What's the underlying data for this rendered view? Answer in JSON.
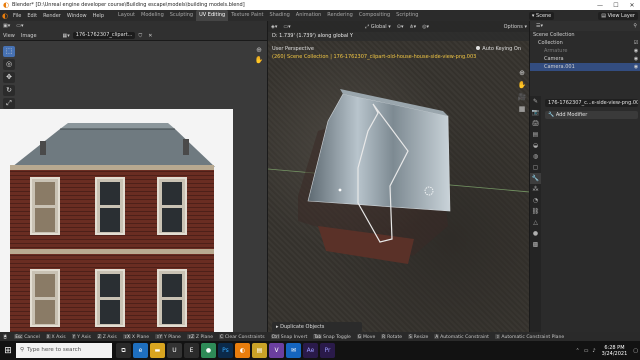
{
  "window": {
    "title": "Blender* [D:\\Unreal engine developer course\\Building escape\\models\\building models.blend]",
    "minimize": "—",
    "maximize": "☐",
    "close": "✕"
  },
  "menubar": {
    "items": [
      "File",
      "Edit",
      "Render",
      "Window",
      "Help"
    ]
  },
  "workspaces": {
    "tabs": [
      "Layout",
      "Modeling",
      "Sculpting",
      "UV Editing",
      "Texture Paint",
      "Shading",
      "Animation",
      "Rendering",
      "Compositing",
      "Scripting"
    ],
    "active_index": 3
  },
  "scene": {
    "scene_name": "Scene",
    "view_layer": "View Layer"
  },
  "image_editor": {
    "view_label": "View",
    "image_label": "Image",
    "image_name": "176-1762307_clipart..."
  },
  "viewport": {
    "mode": "Object Mode",
    "hint": "D: 1.739' (1.739') along global Y",
    "orientation": "Global",
    "options_label": "Options",
    "perspective_label": "User Perspective",
    "collection_info": "(260) Scene Collection | 176-1762307_clipart-old-house-house-side-view-png.003",
    "auto_keying": "Auto Keying On",
    "last_operator": "Duplicate Objects"
  },
  "outliner": {
    "header": "Scene Collection",
    "rows": [
      {
        "name": "Collection",
        "selected": false,
        "dim": false
      },
      {
        "name": "Armature",
        "selected": false,
        "dim": true
      },
      {
        "name": "Camera",
        "selected": false,
        "dim": false
      },
      {
        "name": "Camera.001",
        "selected": true,
        "dim": false
      }
    ]
  },
  "properties": {
    "object_name": "176-1762307_c...e-side-view-png.003",
    "add_modifier": "Add Modifier"
  },
  "statusbar": {
    "items": [
      {
        "key": "Esc",
        "label": "Cancel"
      },
      {
        "key": "X",
        "label": "X Axis"
      },
      {
        "key": "Y",
        "label": "Y Axis"
      },
      {
        "key": "Z",
        "label": "Z Axis"
      },
      {
        "key": "⇧X",
        "label": "X Plane"
      },
      {
        "key": "⇧Y",
        "label": "Y Plane"
      },
      {
        "key": "⇧Z",
        "label": "Z Plane"
      },
      {
        "key": "C",
        "label": "Clear Constraints"
      },
      {
        "key": "Ctrl",
        "label": "Snap Invert"
      },
      {
        "key": "Tab",
        "label": "Snap Toggle"
      },
      {
        "key": "G",
        "label": "Move"
      },
      {
        "key": "R",
        "label": "Rotate"
      },
      {
        "key": "S",
        "label": "Resize"
      },
      {
        "key": "A",
        "label": "Automatic Constraint"
      },
      {
        "key": "⇧",
        "label": "Automatic Constraint Plane"
      }
    ]
  },
  "taskbar": {
    "search_placeholder": "Type here to search",
    "apps": [
      {
        "name": "task-view",
        "glyph": "⧉",
        "color": "#2a2a2a"
      },
      {
        "name": "edge",
        "glyph": "e",
        "color": "#1e6fbf"
      },
      {
        "name": "explorer",
        "glyph": "▬",
        "color": "#d9a520"
      },
      {
        "name": "unreal",
        "glyph": "U",
        "color": "#333333"
      },
      {
        "name": "epic",
        "glyph": "E",
        "color": "#2b2b2b"
      },
      {
        "name": "chrome",
        "glyph": "●",
        "color": "#2e8b57"
      },
      {
        "name": "photoshop",
        "glyph": "Ps",
        "color": "#0b2a4a"
      },
      {
        "name": "blender",
        "glyph": "◐",
        "color": "#e87d0d"
      },
      {
        "name": "stickies",
        "glyph": "▤",
        "color": "#c9a227"
      },
      {
        "name": "visual-studio",
        "glyph": "V",
        "color": "#6b3fa0"
      },
      {
        "name": "mail",
        "glyph": "✉",
        "color": "#1565c0"
      },
      {
        "name": "after-effects",
        "glyph": "Ae",
        "color": "#2a1a4a"
      },
      {
        "name": "premiere",
        "glyph": "Pr",
        "color": "#2a1a4a"
      }
    ],
    "time": "6:28 PM",
    "date": "3/24/2021"
  },
  "colors": {
    "accent": "#4772b3",
    "blender_orange": "#e87d0d",
    "collection_text": "#f2c744",
    "selection": "#334d80"
  }
}
